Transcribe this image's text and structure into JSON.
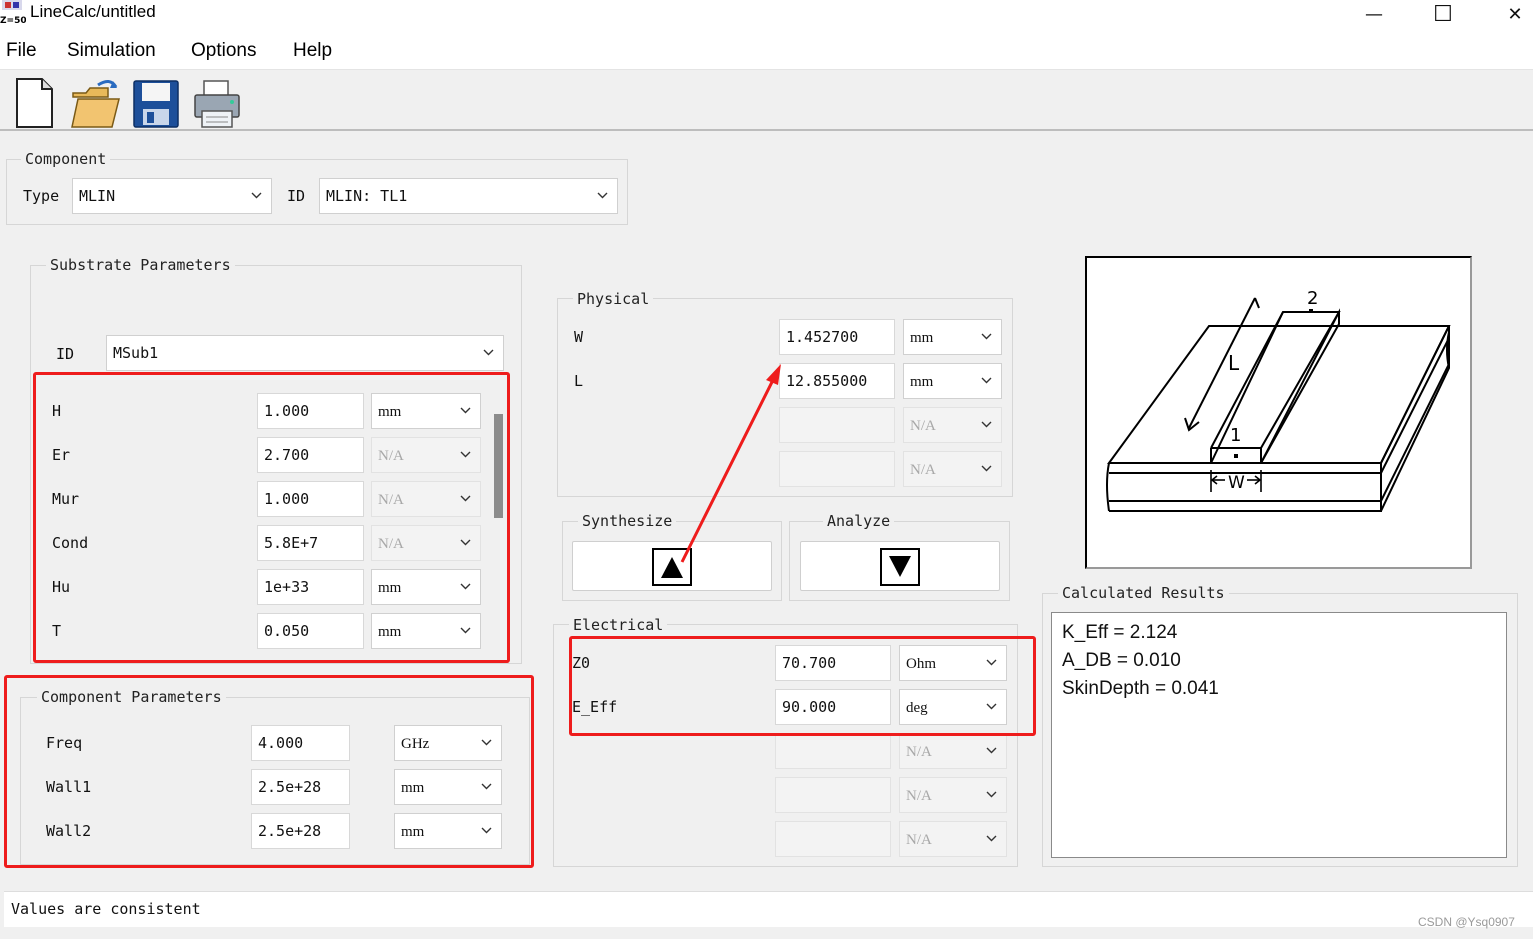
{
  "window": {
    "title": "LineCalc/untitled",
    "app_icon_label": "Z=50",
    "minimize_glyph": "—",
    "maximize_glyph": "☐",
    "close_glyph": "✕"
  },
  "menu": {
    "file": "File",
    "simulation": "Simulation",
    "options": "Options",
    "help": "Help"
  },
  "toolbar": {
    "icons": [
      "new-document-icon",
      "open-folder-icon",
      "save-disk-icon",
      "printer-icon"
    ]
  },
  "component": {
    "legend": "Component",
    "type_label": "Type",
    "type_value": "MLIN",
    "id_label": "ID",
    "id_value": "MLIN: TL1"
  },
  "substrate": {
    "legend": "Substrate Parameters",
    "id_label": "ID",
    "id_value": "MSub1",
    "rows": [
      {
        "label": "H",
        "value": "1.000",
        "unit": "mm",
        "unit_enabled": true
      },
      {
        "label": "Er",
        "value": "2.700",
        "unit": "N/A",
        "unit_enabled": false
      },
      {
        "label": "Mur",
        "value": "1.000",
        "unit": "N/A",
        "unit_enabled": false
      },
      {
        "label": "Cond",
        "value": "5.8E+7",
        "unit": "N/A",
        "unit_enabled": false
      },
      {
        "label": "Hu",
        "value": "1e+33",
        "unit": "mm",
        "unit_enabled": true
      },
      {
        "label": "T",
        "value": "0.050",
        "unit": "mm",
        "unit_enabled": true
      }
    ]
  },
  "component_params": {
    "legend": "Component Parameters",
    "rows": [
      {
        "label": "Freq",
        "value": "4.000",
        "unit": "GHz"
      },
      {
        "label": "Wall1",
        "value": "2.5e+28",
        "unit": "mm"
      },
      {
        "label": "Wall2",
        "value": "2.5e+28",
        "unit": "mm"
      }
    ]
  },
  "physical": {
    "legend": "Physical",
    "rows": [
      {
        "label": "W",
        "value": "1.452700",
        "unit": "mm",
        "enabled": true
      },
      {
        "label": "L",
        "value": "12.855000",
        "unit": "mm",
        "enabled": true
      },
      {
        "label": "",
        "value": "",
        "unit": "N/A",
        "enabled": false
      },
      {
        "label": "",
        "value": "",
        "unit": "N/A",
        "enabled": false
      }
    ]
  },
  "synthesize": {
    "legend": "Synthesize",
    "icon": "up-triangle-icon"
  },
  "analyze": {
    "legend": "Analyze",
    "icon": "down-triangle-icon"
  },
  "electrical": {
    "legend": "Electrical",
    "rows": [
      {
        "label": "Z0",
        "value": "70.700",
        "unit": "Ohm",
        "enabled": true
      },
      {
        "label": "E_Eff",
        "value": "90.000",
        "unit": "deg",
        "enabled": true
      },
      {
        "label": "",
        "value": "",
        "unit": "N/A",
        "enabled": false
      },
      {
        "label": "",
        "value": "",
        "unit": "N/A",
        "enabled": false
      },
      {
        "label": "",
        "value": "",
        "unit": "N/A",
        "enabled": false
      }
    ]
  },
  "diagram": {
    "port1": "1",
    "port2": "2",
    "length_label": "L",
    "width_label": "W"
  },
  "results": {
    "legend": "Calculated Results",
    "lines": [
      "K_Eff = 2.124",
      "A_DB = 0.010",
      "SkinDepth = 0.041"
    ]
  },
  "status": {
    "text": "Values are consistent"
  },
  "watermark": "CSDN @Ysq0907",
  "colors": {
    "annotation_red": "#ee1c1c",
    "window_bg": "#f0f0f0"
  }
}
